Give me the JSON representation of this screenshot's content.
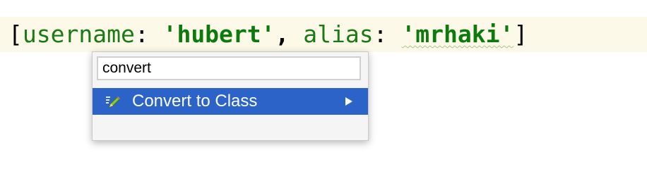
{
  "editor": {
    "code": {
      "open_bracket": "[",
      "key1": "username",
      "colon1": ": ",
      "val1": "'hubert'",
      "comma": ", ",
      "key2": "alias",
      "colon2": ": ",
      "val2": "'mrhaki'",
      "close_bracket": "]"
    }
  },
  "intention_popup": {
    "search": {
      "value": "convert"
    },
    "items": [
      {
        "label": "Convert to Class",
        "icon": "edit-pencil-icon",
        "has_submenu": true,
        "selected": true
      }
    ]
  },
  "colors": {
    "line_highlight": "#fdf9e8",
    "key": "#1a7a14",
    "string": "#0d7a0d",
    "selection": "#2b63c9"
  }
}
